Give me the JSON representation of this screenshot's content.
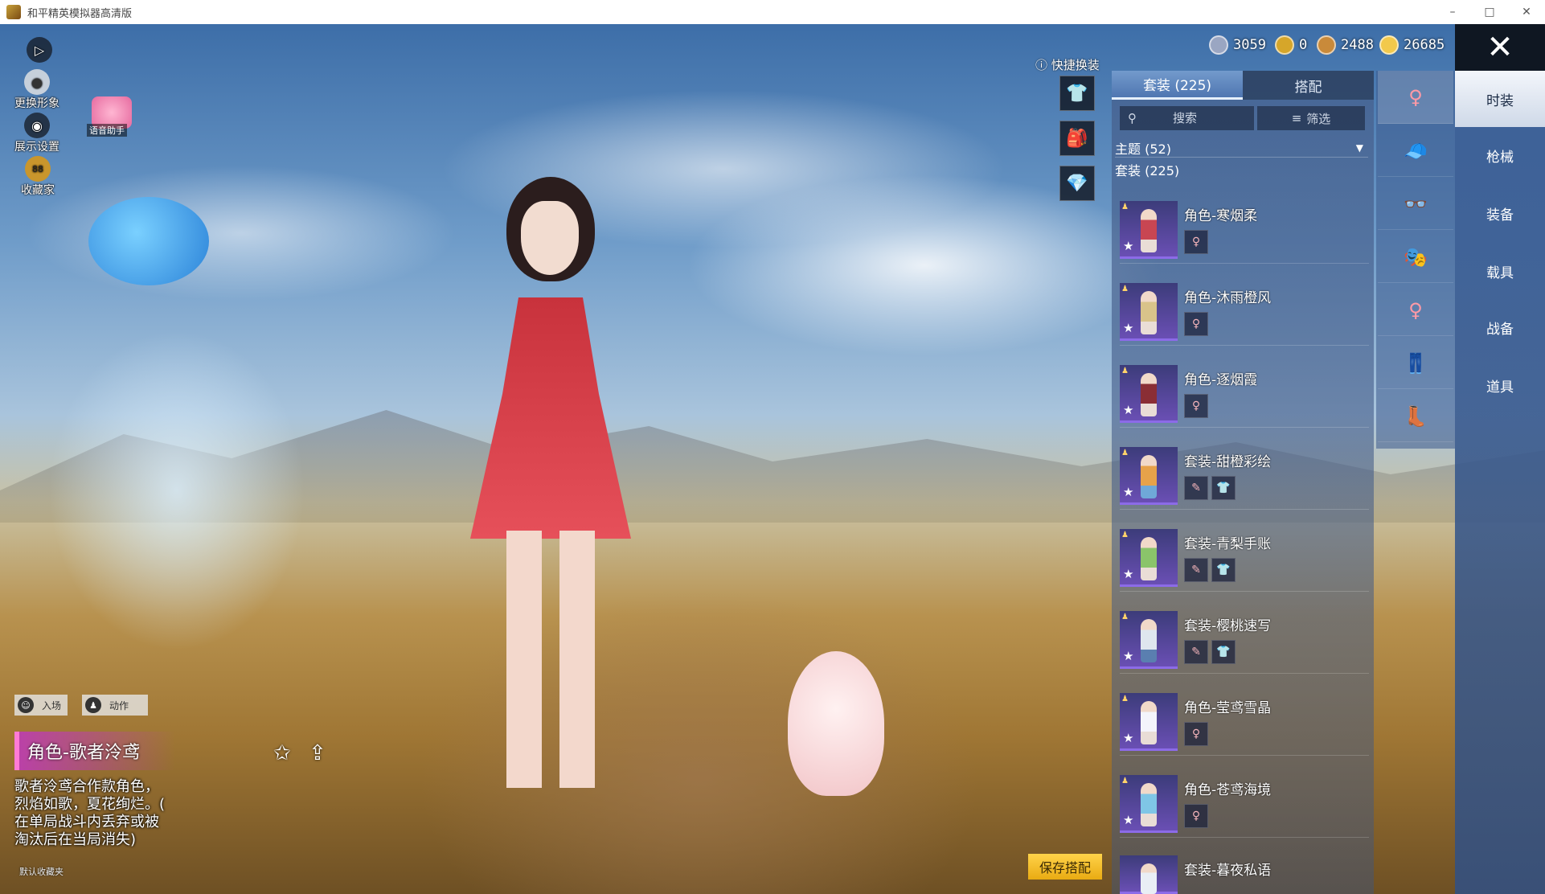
{
  "window": {
    "title": "和平精英模拟器高清版",
    "controls": [
      "–",
      "□",
      "✕"
    ]
  },
  "top_left": {
    "expand_icon": "▷",
    "change_avatar": "更换形象",
    "display_settings": "展示设置",
    "collector_badge": "88",
    "collector": "收藏家",
    "voice_helper": "语音助手"
  },
  "currency": [
    {
      "value": "3059",
      "color": "#9aa6c2"
    },
    {
      "value": "0",
      "color": "#d6a62a"
    },
    {
      "value": "2488",
      "color": "#c98a3a"
    },
    {
      "value": "26685",
      "color": "#f2c94c"
    }
  ],
  "quick_change": {
    "label": "快捷换装",
    "icons": [
      "👕",
      "🎒",
      "💎"
    ]
  },
  "tabs": [
    {
      "label": "套装 (225)",
      "active": true
    },
    {
      "label": "搭配",
      "active": false
    }
  ],
  "search": {
    "placeholder": "搜索",
    "filter_label": "筛选"
  },
  "theme_row": {
    "label": "主题 (52)",
    "arrow": "▼"
  },
  "subtitle": "套装 (225)",
  "items": [
    {
      "name": "角色-寒烟柔",
      "minis": 1
    },
    {
      "name": "角色-沐雨橙风",
      "minis": 1
    },
    {
      "name": "角色-逐烟霞",
      "minis": 1
    },
    {
      "name": "套装-甜橙彩绘",
      "minis": 2
    },
    {
      "name": "套装-青梨手账",
      "minis": 2
    },
    {
      "name": "套装-樱桃速写",
      "minis": 2
    },
    {
      "name": "角色-莹鸢雪晶",
      "minis": 1
    },
    {
      "name": "角色-苍鸢海境",
      "minis": 1
    },
    {
      "name": "套装-暮夜私语",
      "minis": 0
    }
  ],
  "slots": [
    "♀",
    "🧢",
    "👓",
    "🎭",
    "♀",
    "👖",
    "👢"
  ],
  "rail": [
    {
      "label": "时装",
      "active": true
    },
    {
      "label": "枪械",
      "active": false
    },
    {
      "label": "装备",
      "active": false
    },
    {
      "label": "载具",
      "active": false
    },
    {
      "label": "战备",
      "active": false
    },
    {
      "label": "道具",
      "active": false
    }
  ],
  "close_icon": "✕",
  "bottom_left": {
    "entrance": "入场",
    "action": "动作",
    "char_title": "角色-歌者泠鸢",
    "description": [
      "歌者泠鸢合作款角色，",
      "烈焰如歌，夏花绚烂。(",
      "在单局战斗内丢弃或被",
      "淘汰后在当局消失)"
    ],
    "fav_folder": "默认收藏夹"
  },
  "save_button": "保存搭配"
}
